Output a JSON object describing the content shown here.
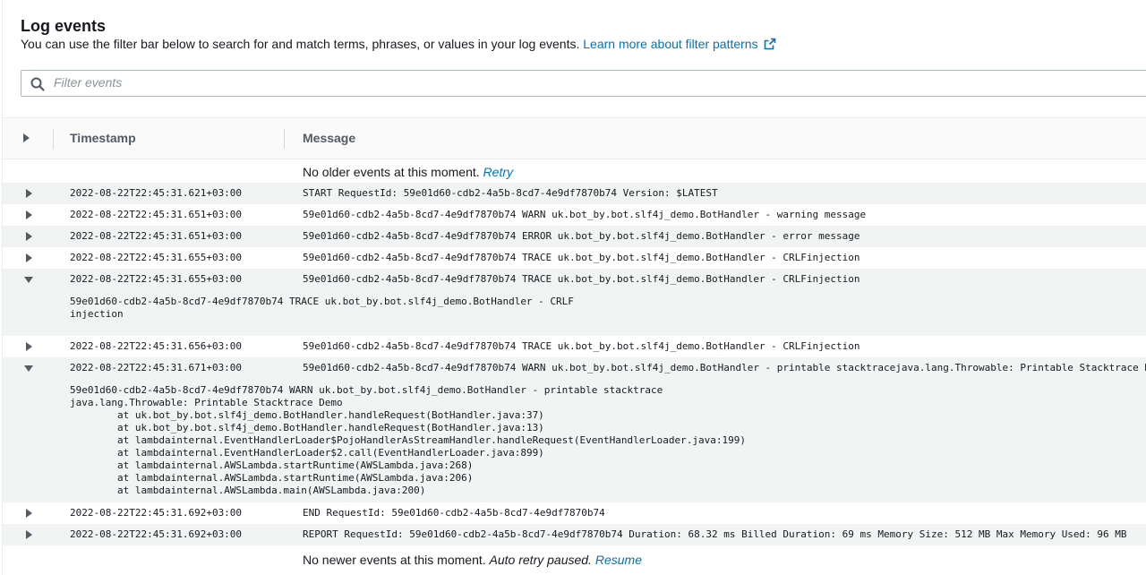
{
  "header": {
    "title": "Log events",
    "description": "You can use the filter bar below to search for and match terms, phrases, or values in your log events.",
    "learn_more": "Learn more about filter patterns"
  },
  "filter": {
    "placeholder": "Filter events",
    "value": ""
  },
  "columns": {
    "timestamp": "Timestamp",
    "message": "Message"
  },
  "top_notice": {
    "text": "No older events at this moment.",
    "retry": "Retry"
  },
  "events": [
    {
      "ts": "2022-08-22T22:45:31.621+03:00",
      "msg": "START RequestId: 59e01d60-cdb2-4a5b-8cd7-4e9df7870b74 Version: $LATEST"
    },
    {
      "ts": "2022-08-22T22:45:31.651+03:00",
      "msg": "59e01d60-cdb2-4a5b-8cd7-4e9df7870b74 WARN uk.bot_by.bot.slf4j_demo.BotHandler - warning message"
    },
    {
      "ts": "2022-08-22T22:45:31.651+03:00",
      "msg": "59e01d60-cdb2-4a5b-8cd7-4e9df7870b74 ERROR uk.bot_by.bot.slf4j_demo.BotHandler - error message"
    },
    {
      "ts": "2022-08-22T22:45:31.655+03:00",
      "msg": "59e01d60-cdb2-4a5b-8cd7-4e9df7870b74 TRACE uk.bot_by.bot.slf4j_demo.BotHandler - CRLFinjection"
    },
    {
      "ts": "2022-08-22T22:45:31.655+03:00",
      "msg": "59e01d60-cdb2-4a5b-8cd7-4e9df7870b74 TRACE uk.bot_by.bot.slf4j_demo.BotHandler - CRLFinjection",
      "detail": "59e01d60-cdb2-4a5b-8cd7-4e9df7870b74 TRACE uk.bot_by.bot.slf4j_demo.BotHandler - CRLF\ninjection"
    },
    {
      "ts": "2022-08-22T22:45:31.656+03:00",
      "msg": "59e01d60-cdb2-4a5b-8cd7-4e9df7870b74 TRACE uk.bot_by.bot.slf4j_demo.BotHandler - CRLFinjection"
    },
    {
      "ts": "2022-08-22T22:45:31.671+03:00",
      "msg": "59e01d60-cdb2-4a5b-8cd7-4e9df7870b74 WARN uk.bot_by.bot.slf4j_demo.BotHandler - printable stacktracejava.lang.Throwable: Printable Stacktrace Demo",
      "detail": "59e01d60-cdb2-4a5b-8cd7-4e9df7870b74 WARN uk.bot_by.bot.slf4j_demo.BotHandler - printable stacktrace\njava.lang.Throwable: Printable Stacktrace Demo\n\tat uk.bot_by.bot.slf4j_demo.BotHandler.handleRequest(BotHandler.java:37)\n\tat uk.bot_by.bot.slf4j_demo.BotHandler.handleRequest(BotHandler.java:13)\n\tat lambdainternal.EventHandlerLoader$PojoHandlerAsStreamHandler.handleRequest(EventHandlerLoader.java:199)\n\tat lambdainternal.EventHandlerLoader$2.call(EventHandlerLoader.java:899)\n\tat lambdainternal.AWSLambda.startRuntime(AWSLambda.java:268)\n\tat lambdainternal.AWSLambda.startRuntime(AWSLambda.java:206)\n\tat lambdainternal.AWSLambda.main(AWSLambda.java:200)"
    },
    {
      "ts": "2022-08-22T22:45:31.692+03:00",
      "msg": "END RequestId: 59e01d60-cdb2-4a5b-8cd7-4e9df7870b74"
    },
    {
      "ts": "2022-08-22T22:45:31.692+03:00",
      "msg": "REPORT RequestId: 59e01d60-cdb2-4a5b-8cd7-4e9df7870b74 Duration: 68.32 ms Billed Duration: 69 ms Memory Size: 512 MB Max Memory Used: 96 MB"
    }
  ],
  "bottom_notice": {
    "text": "No newer events at this moment.",
    "paused": "Auto retry paused.",
    "resume": "Resume"
  }
}
